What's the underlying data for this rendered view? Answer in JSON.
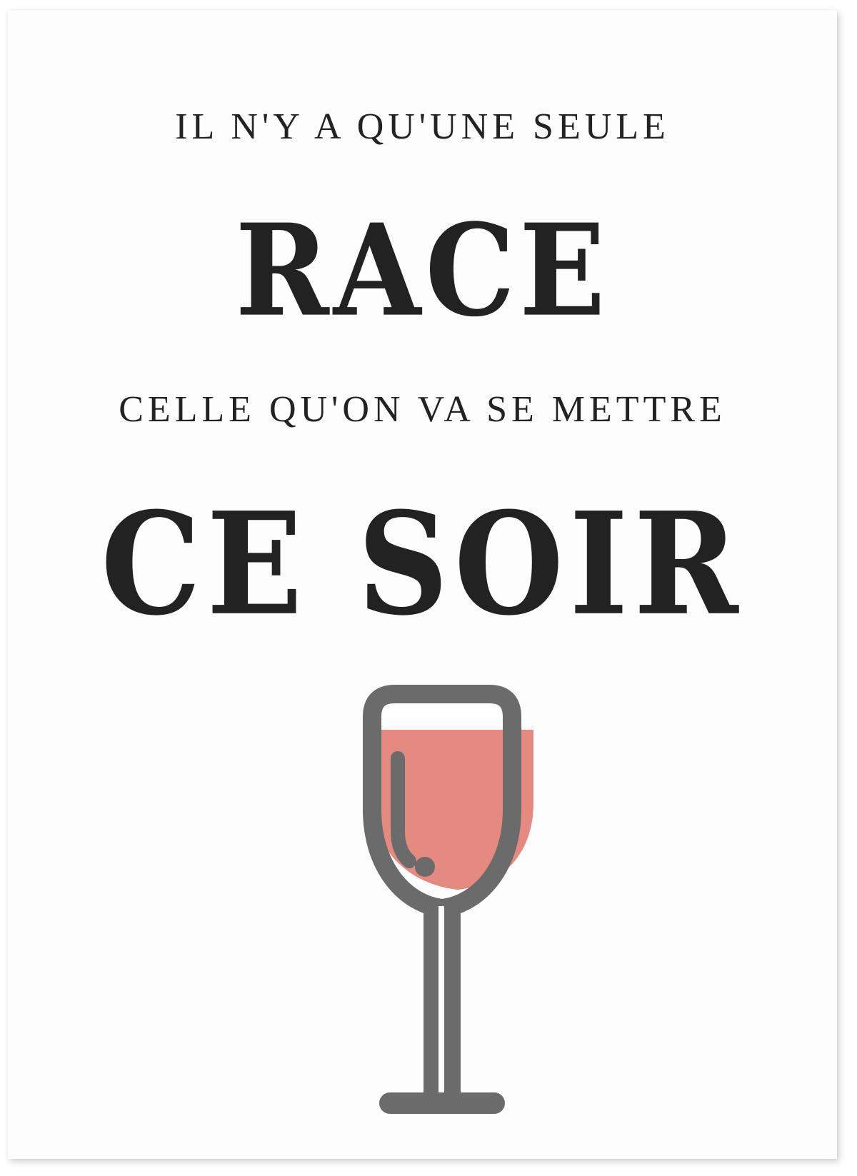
{
  "poster": {
    "line1": "IL N'Y A QU'UNE SEULE",
    "line2": "RACE",
    "line3": "CELLE QU'ON VA SE METTRE",
    "line4": "CE SOIR"
  },
  "illustration": {
    "icon": "wine-glass-icon",
    "wine_color": "#e58a80",
    "outline_color": "#6b6b6b"
  },
  "colors": {
    "text": "#222222",
    "background": "#fdfdfd"
  }
}
